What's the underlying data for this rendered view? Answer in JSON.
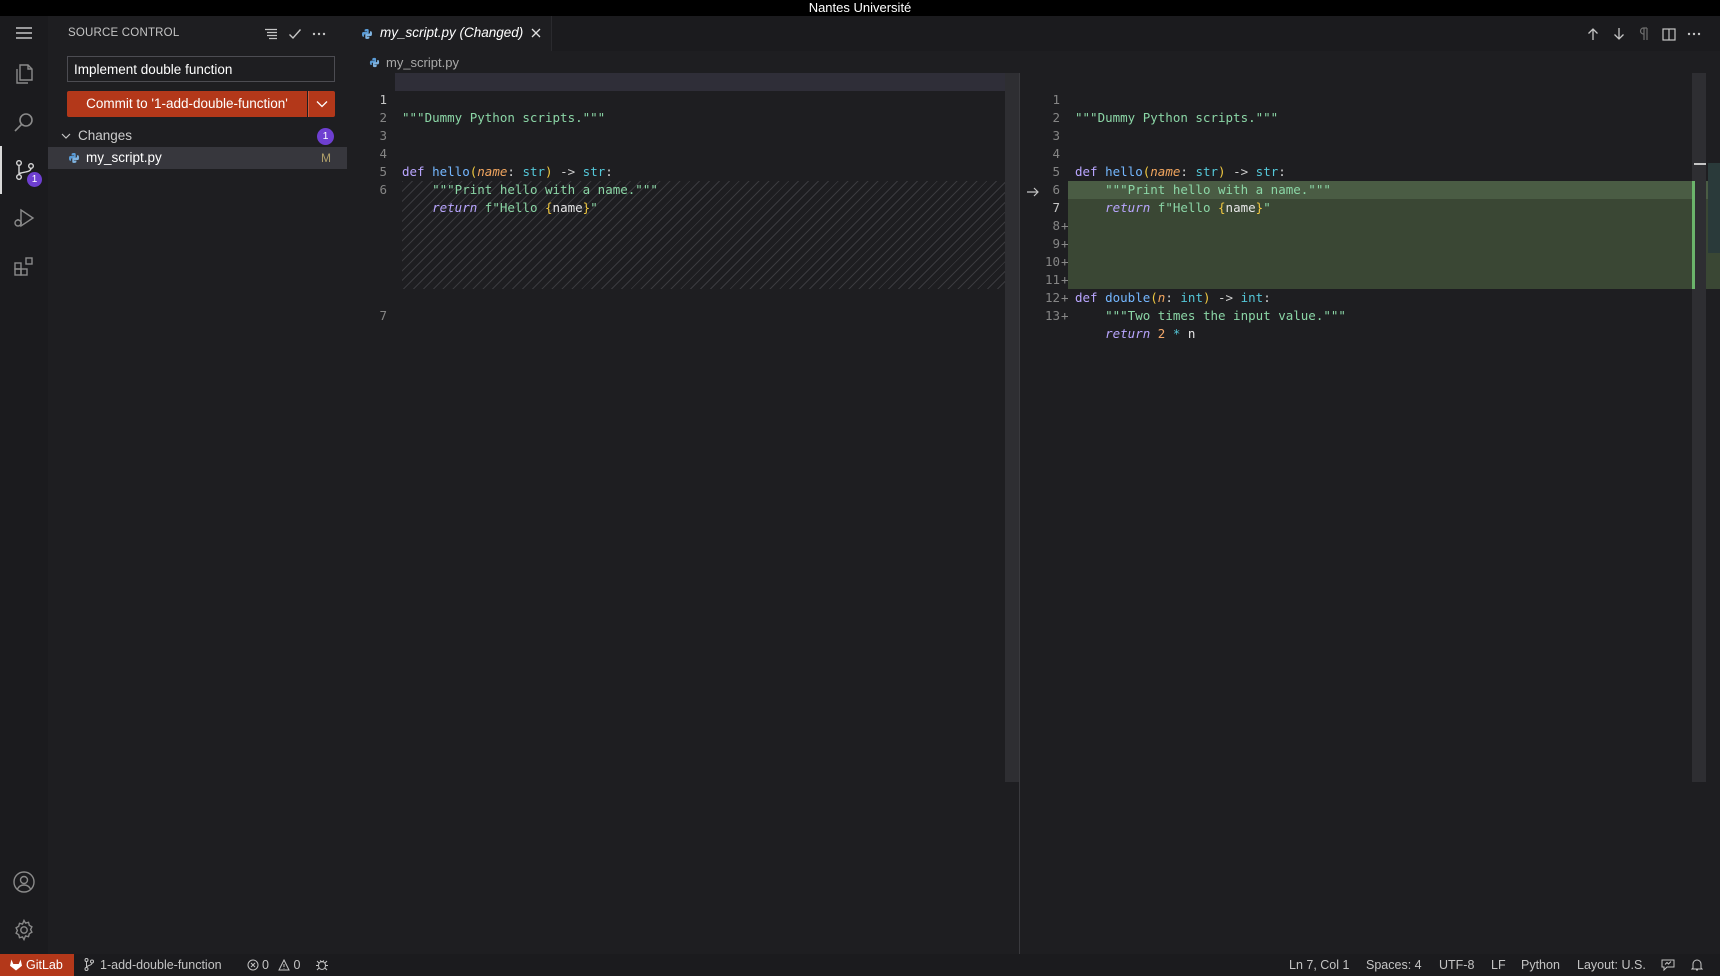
{
  "window": {
    "title": "Nantes Université"
  },
  "activity_bar": {
    "scm_badge": "1"
  },
  "sidebar": {
    "title": "SOURCE CONTROL",
    "commit_message": "Implement double function",
    "commit_button": "Commit to '1-add-double-function'",
    "changes_label": "Changes",
    "changes_count": "1",
    "file": {
      "name": "my_script.py",
      "status": "M"
    }
  },
  "editor": {
    "tab_label": "my_script.py (Changed)",
    "breadcrumb": "my_script.py",
    "original_numbers": [
      "1",
      "2",
      "3",
      "4",
      "5",
      "6",
      "7"
    ],
    "modified_numbers": [
      "1",
      "2",
      "3",
      "4",
      "5",
      "6",
      "7",
      "8",
      "9",
      "10",
      "11",
      "12",
      "13"
    ],
    "added_marker": "+",
    "code": {
      "docstring_module": "\"\"\"Dummy Python scripts.\"\"\"",
      "kw_def": "def",
      "fn_hello": "hello",
      "paren_open": "(",
      "paren_close": ")",
      "param_name": "name",
      "colon": ":",
      "type_str": "str",
      "arrow": " -> ",
      "doc_hello": "\"\"\"Print hello with a name.\"\"\"",
      "kw_return": "return",
      "fstring_start": "f\"Hello ",
      "brace_open": "{",
      "var_name": "name",
      "brace_close": "}",
      "fstring_end": "\"",
      "fn_double": "double",
      "param_n": "n",
      "type_int": "int",
      "doc_double": "\"\"\"Two times the input value.\"\"\"",
      "num_two": "2",
      "op_mul": "*",
      "var_n": "n"
    }
  },
  "status_bar": {
    "remote": "GitLab",
    "branch": "1-add-double-function",
    "errors": "0",
    "warnings": "0",
    "cursor": "Ln 7, Col 1",
    "spaces": "Spaces: 4",
    "encoding": "UTF-8",
    "eol": "LF",
    "language": "Python",
    "layout": "Layout: U.S."
  }
}
